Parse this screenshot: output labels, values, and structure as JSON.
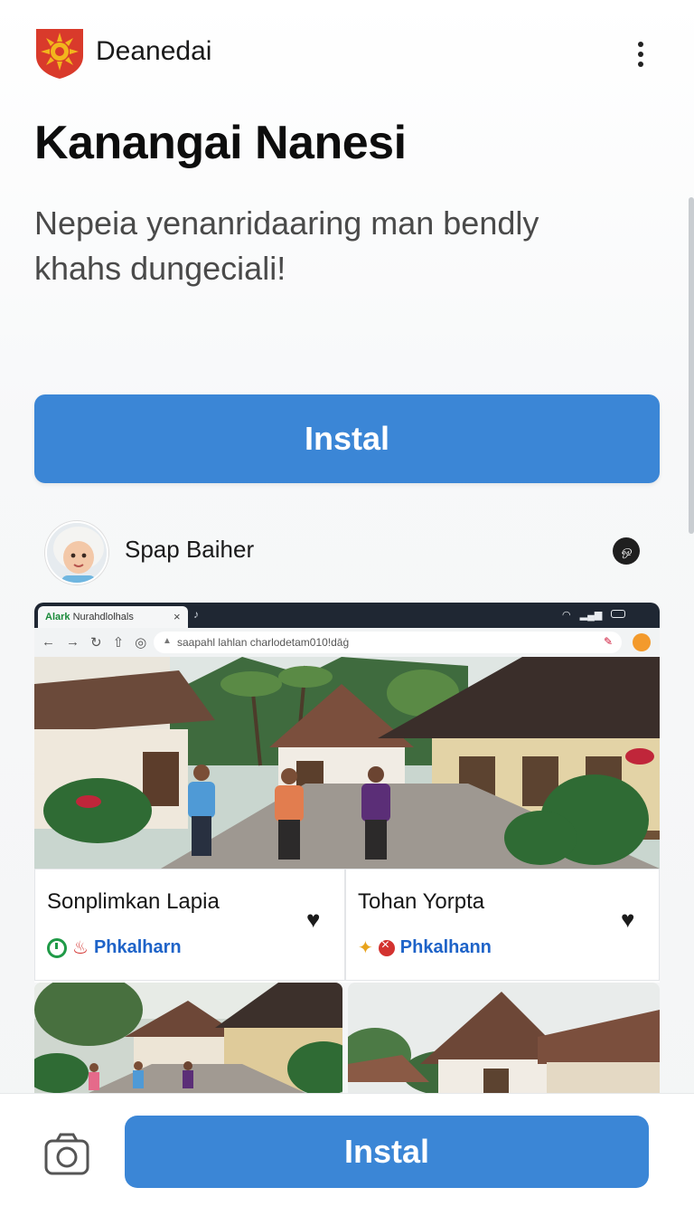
{
  "header": {
    "app_name": "Deanedai",
    "logo_icon": "sun-crest-logo",
    "menu_icon": "more-vertical-icon"
  },
  "hero": {
    "title": "Kanangai Nanesi",
    "subtitle": "Nepeia yenanridaaring man bendly khahs dungeciali!"
  },
  "install_label": "Instal",
  "profile": {
    "name": "Spap Baiher",
    "badge_text": "ஒ"
  },
  "browser": {
    "tab_brand": "Alark",
    "tab_title": "Nurahdlolhals",
    "url": "saapahl lahlan charlodetam010!dāġ"
  },
  "tiles": [
    {
      "title": "Sonplimkan Lapia",
      "tag": "Phkalharn"
    },
    {
      "title": "Tohan Yorpta",
      "tag": "Phkalhann"
    }
  ],
  "bottom_bar": {
    "camera_icon": "camera-icon",
    "install_label": "Instal"
  },
  "colors": {
    "accent": "#3b86d6",
    "tag_blue": "#1e63c8",
    "logo_red": "#d93a2b",
    "logo_gold": "#f2b51d"
  }
}
